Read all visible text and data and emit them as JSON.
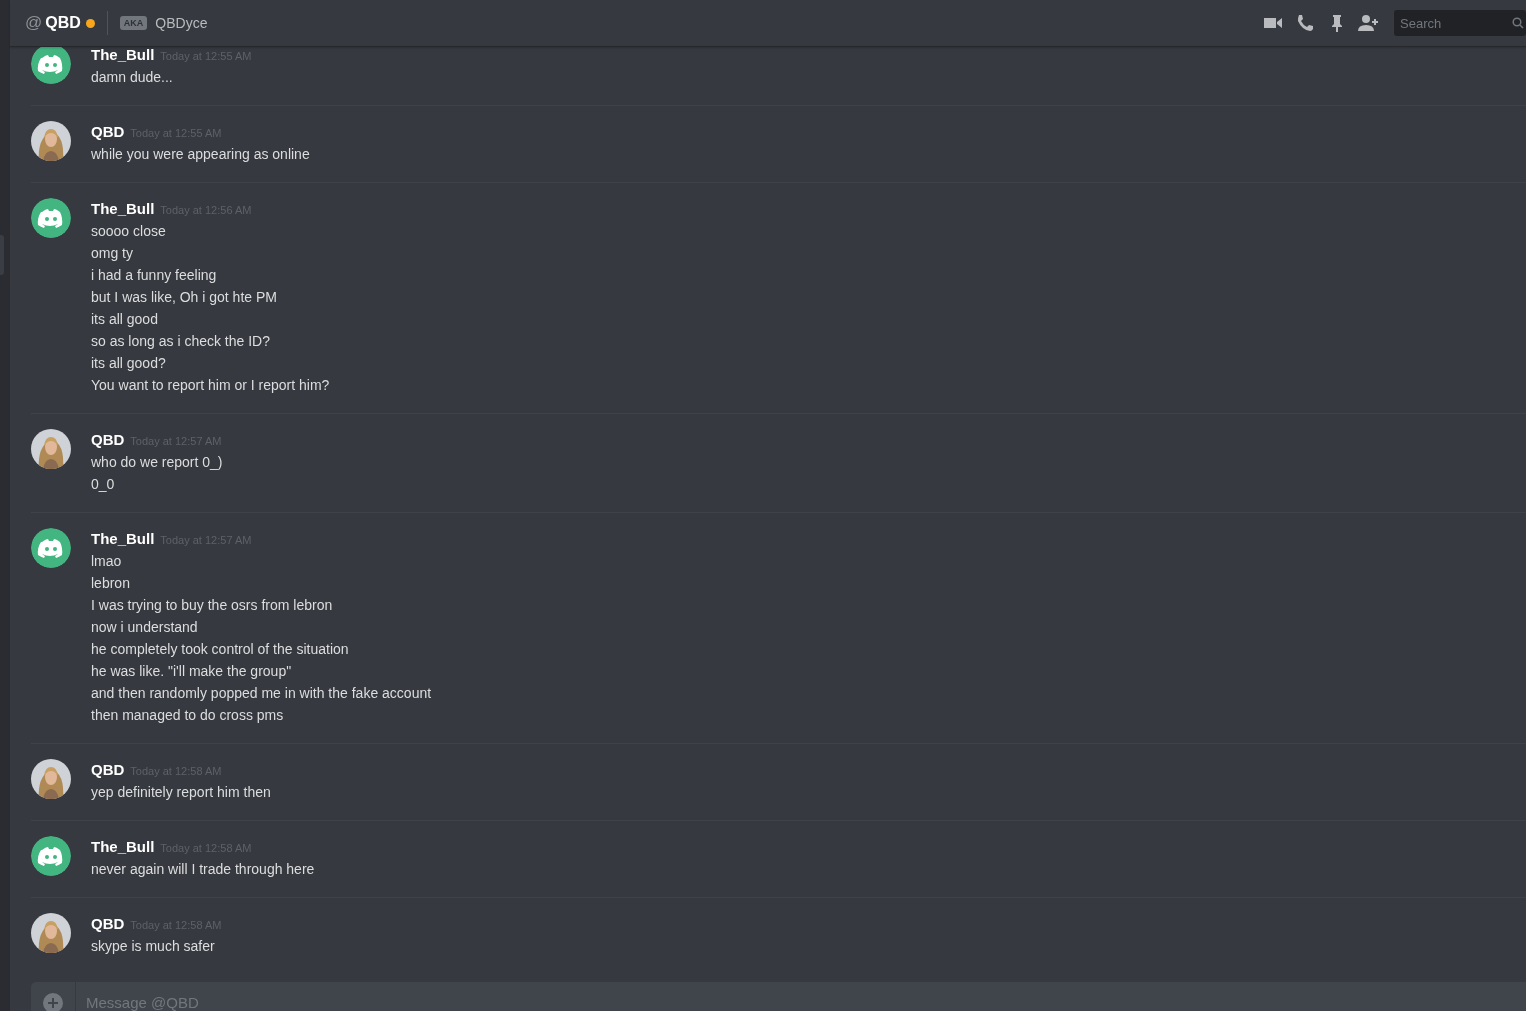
{
  "header": {
    "at_sign": "@",
    "name": "QBD",
    "status": {
      "color": "#faa61a"
    },
    "aka_badge": "AKA",
    "aka_name": "QBDyce",
    "search": {
      "placeholder": "Search"
    }
  },
  "messages": [
    {
      "author": "The_Bull",
      "kind": "bot-logo",
      "time": "Today at 12:55 AM",
      "lines": [
        "damn dude..."
      ]
    },
    {
      "author": "QBD",
      "time": "Today at 12:55 AM",
      "lines": [
        "while you were appearing as online"
      ]
    },
    {
      "author": "The_Bull",
      "kind": "bot-logo",
      "time": "Today at 12:56 AM",
      "lines": [
        "soooo close",
        "omg ty",
        "i had a funny feeling",
        "but I was like, Oh i got hte PM",
        "its all good",
        "so as long as i check the ID?",
        "its all good?",
        "You want to report him or I report him?"
      ]
    },
    {
      "author": "QBD",
      "time": "Today at 12:57 AM",
      "lines": [
        "who do we report 0_)",
        "0_0"
      ]
    },
    {
      "author": "The_Bull",
      "kind": "bot-logo",
      "time": "Today at 12:57 AM",
      "lines": [
        "lmao",
        "lebron",
        "I was trying to buy the osrs from lebron",
        "now i understand",
        "he completely took control of the situation",
        "he was like. \"i'll make the group\"",
        "and then randomly popped me in with the fake account",
        "then managed to do cross pms"
      ]
    },
    {
      "author": "QBD",
      "time": "Today at 12:58 AM",
      "lines": [
        "yep definitely report him then"
      ]
    },
    {
      "author": "The_Bull",
      "kind": "bot-logo",
      "time": "Today at 12:58 AM",
      "lines": [
        "never again will I trade through here"
      ]
    },
    {
      "author": "QBD",
      "time": "Today at 12:58 AM",
      "lines": [
        "skype is much safer"
      ]
    }
  ],
  "composer": {
    "placeholder": "Message @QBD"
  }
}
